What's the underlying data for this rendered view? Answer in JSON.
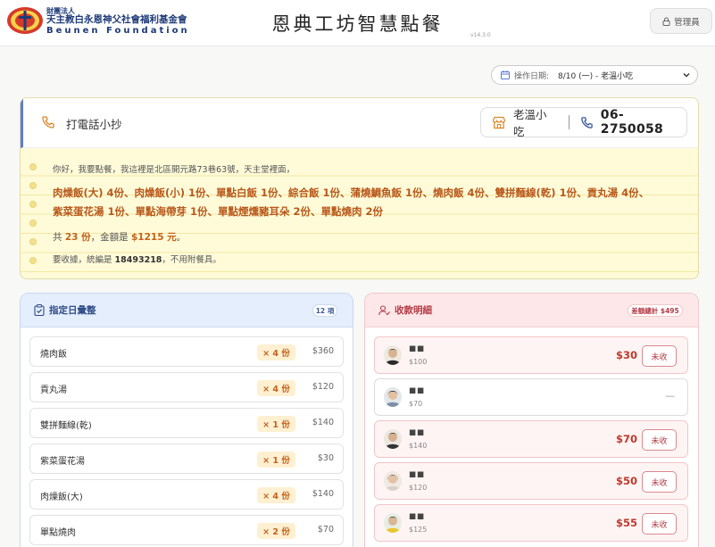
{
  "header": {
    "org_small": "財團法人",
    "org_name": "天主教白永恩神父社會福利基金會",
    "org_en": "Beunen Foundation",
    "title": "恩典工坊智慧點餐",
    "version": "v14.3.0",
    "admin_label": "管理員"
  },
  "date_select": {
    "label": "操作日期:",
    "value": "8/10 (一) - 老溫小吃"
  },
  "phone_note": {
    "title": "打電話小抄",
    "store_name": "老溫小吃",
    "store_phone": "06-2750058",
    "greeting": "你好，我要點餐，我這裡是北區開元路73巷63號，天主堂裡面，",
    "order_line1": "肉燥飯(大) 4份、肉燥飯(小) 1份、單點白飯 1份、綜合飯 1份、蒲燒鯛魚飯 1份、燒肉飯 4份、雙拼麵線(乾) 1份、貢丸湯 4份、",
    "order_line2": "紫菜蛋花湯 1份、單點海帶芽 1份、單點煙燻豬耳朵 2份、單點燒肉 2份",
    "total_prefix": "共 ",
    "total_count": "23 份",
    "total_mid": "，金額是 ",
    "total_amount": "$1215 元",
    "total_suffix": "。",
    "receipt_prefix": "要收據，統編是 ",
    "tax_id": "18493218",
    "receipt_suffix": "，不用附餐具。"
  },
  "summary_panel": {
    "title": "指定日彙整",
    "count_badge": "12 項",
    "items": [
      {
        "name": "燒肉飯",
        "qty": "× 4 份",
        "price": "$360"
      },
      {
        "name": "貢丸湯",
        "qty": "× 4 份",
        "price": "$120"
      },
      {
        "name": "雙拼麵線(乾)",
        "qty": "× 1 份",
        "price": "$140"
      },
      {
        "name": "紫菜蛋花湯",
        "qty": "× 1 份",
        "price": "$30"
      },
      {
        "name": "肉燥飯(大)",
        "qty": "× 4 份",
        "price": "$140"
      },
      {
        "name": "單點燒肉",
        "qty": "× 2 份",
        "price": "$70"
      }
    ]
  },
  "payment_panel": {
    "title": "收款明細",
    "diff_badge": "差額總計 $495",
    "collect_label": "未收",
    "rows": [
      {
        "name": "■■",
        "amount": "$100",
        "due": "$30",
        "collected": false
      },
      {
        "name": "■■",
        "amount": "$70",
        "due": "—",
        "collected": true
      },
      {
        "name": "■■",
        "amount": "$140",
        "due": "$70",
        "collected": false
      },
      {
        "name": "■■",
        "amount": "$120",
        "due": "$50",
        "collected": false
      },
      {
        "name": "■■",
        "amount": "$125",
        "due": "$55",
        "collected": false
      }
    ]
  },
  "colors": {
    "accent_blue": "#5b7bd8",
    "order_text": "#b8581a",
    "due_red": "#c0392b",
    "note_bg": "#fffbd9"
  }
}
